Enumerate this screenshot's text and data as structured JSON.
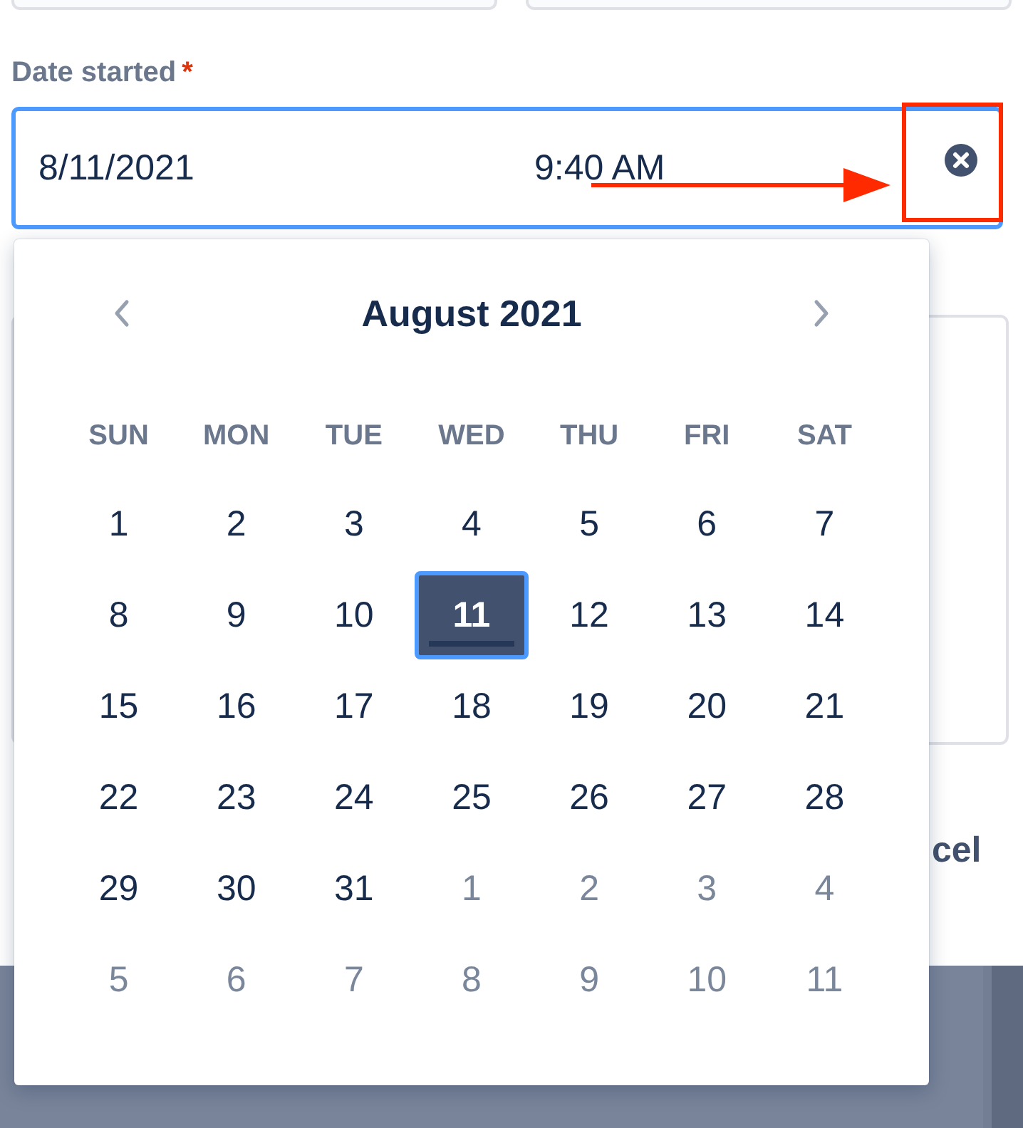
{
  "date_field": {
    "label": "Date started",
    "required_mark": "*",
    "date": "8/11/2021",
    "time": "9:40 AM"
  },
  "cancel_button": {
    "label": "cel"
  },
  "calendar": {
    "title": "August 2021",
    "weekdays": [
      "SUN",
      "MON",
      "TUE",
      "WED",
      "THU",
      "FRI",
      "SAT"
    ],
    "weeks": [
      [
        {
          "day": "1",
          "outside": false,
          "selected": false
        },
        {
          "day": "2",
          "outside": false,
          "selected": false
        },
        {
          "day": "3",
          "outside": false,
          "selected": false
        },
        {
          "day": "4",
          "outside": false,
          "selected": false
        },
        {
          "day": "5",
          "outside": false,
          "selected": false
        },
        {
          "day": "6",
          "outside": false,
          "selected": false
        },
        {
          "day": "7",
          "outside": false,
          "selected": false
        }
      ],
      [
        {
          "day": "8",
          "outside": false,
          "selected": false
        },
        {
          "day": "9",
          "outside": false,
          "selected": false
        },
        {
          "day": "10",
          "outside": false,
          "selected": false
        },
        {
          "day": "11",
          "outside": false,
          "selected": true
        },
        {
          "day": "12",
          "outside": false,
          "selected": false
        },
        {
          "day": "13",
          "outside": false,
          "selected": false
        },
        {
          "day": "14",
          "outside": false,
          "selected": false
        }
      ],
      [
        {
          "day": "15",
          "outside": false,
          "selected": false
        },
        {
          "day": "16",
          "outside": false,
          "selected": false
        },
        {
          "day": "17",
          "outside": false,
          "selected": false
        },
        {
          "day": "18",
          "outside": false,
          "selected": false
        },
        {
          "day": "19",
          "outside": false,
          "selected": false
        },
        {
          "day": "20",
          "outside": false,
          "selected": false
        },
        {
          "day": "21",
          "outside": false,
          "selected": false
        }
      ],
      [
        {
          "day": "22",
          "outside": false,
          "selected": false
        },
        {
          "day": "23",
          "outside": false,
          "selected": false
        },
        {
          "day": "24",
          "outside": false,
          "selected": false
        },
        {
          "day": "25",
          "outside": false,
          "selected": false
        },
        {
          "day": "26",
          "outside": false,
          "selected": false
        },
        {
          "day": "27",
          "outside": false,
          "selected": false
        },
        {
          "day": "28",
          "outside": false,
          "selected": false
        }
      ],
      [
        {
          "day": "29",
          "outside": false,
          "selected": false
        },
        {
          "day": "30",
          "outside": false,
          "selected": false
        },
        {
          "day": "31",
          "outside": false,
          "selected": false
        },
        {
          "day": "1",
          "outside": true,
          "selected": false
        },
        {
          "day": "2",
          "outside": true,
          "selected": false
        },
        {
          "day": "3",
          "outside": true,
          "selected": false
        },
        {
          "day": "4",
          "outside": true,
          "selected": false
        }
      ],
      [
        {
          "day": "5",
          "outside": true,
          "selected": false
        },
        {
          "day": "6",
          "outside": true,
          "selected": false
        },
        {
          "day": "7",
          "outside": true,
          "selected": false
        },
        {
          "day": "8",
          "outside": true,
          "selected": false
        },
        {
          "day": "9",
          "outside": true,
          "selected": false
        },
        {
          "day": "10",
          "outside": true,
          "selected": false
        },
        {
          "day": "11",
          "outside": true,
          "selected": false
        }
      ]
    ]
  }
}
